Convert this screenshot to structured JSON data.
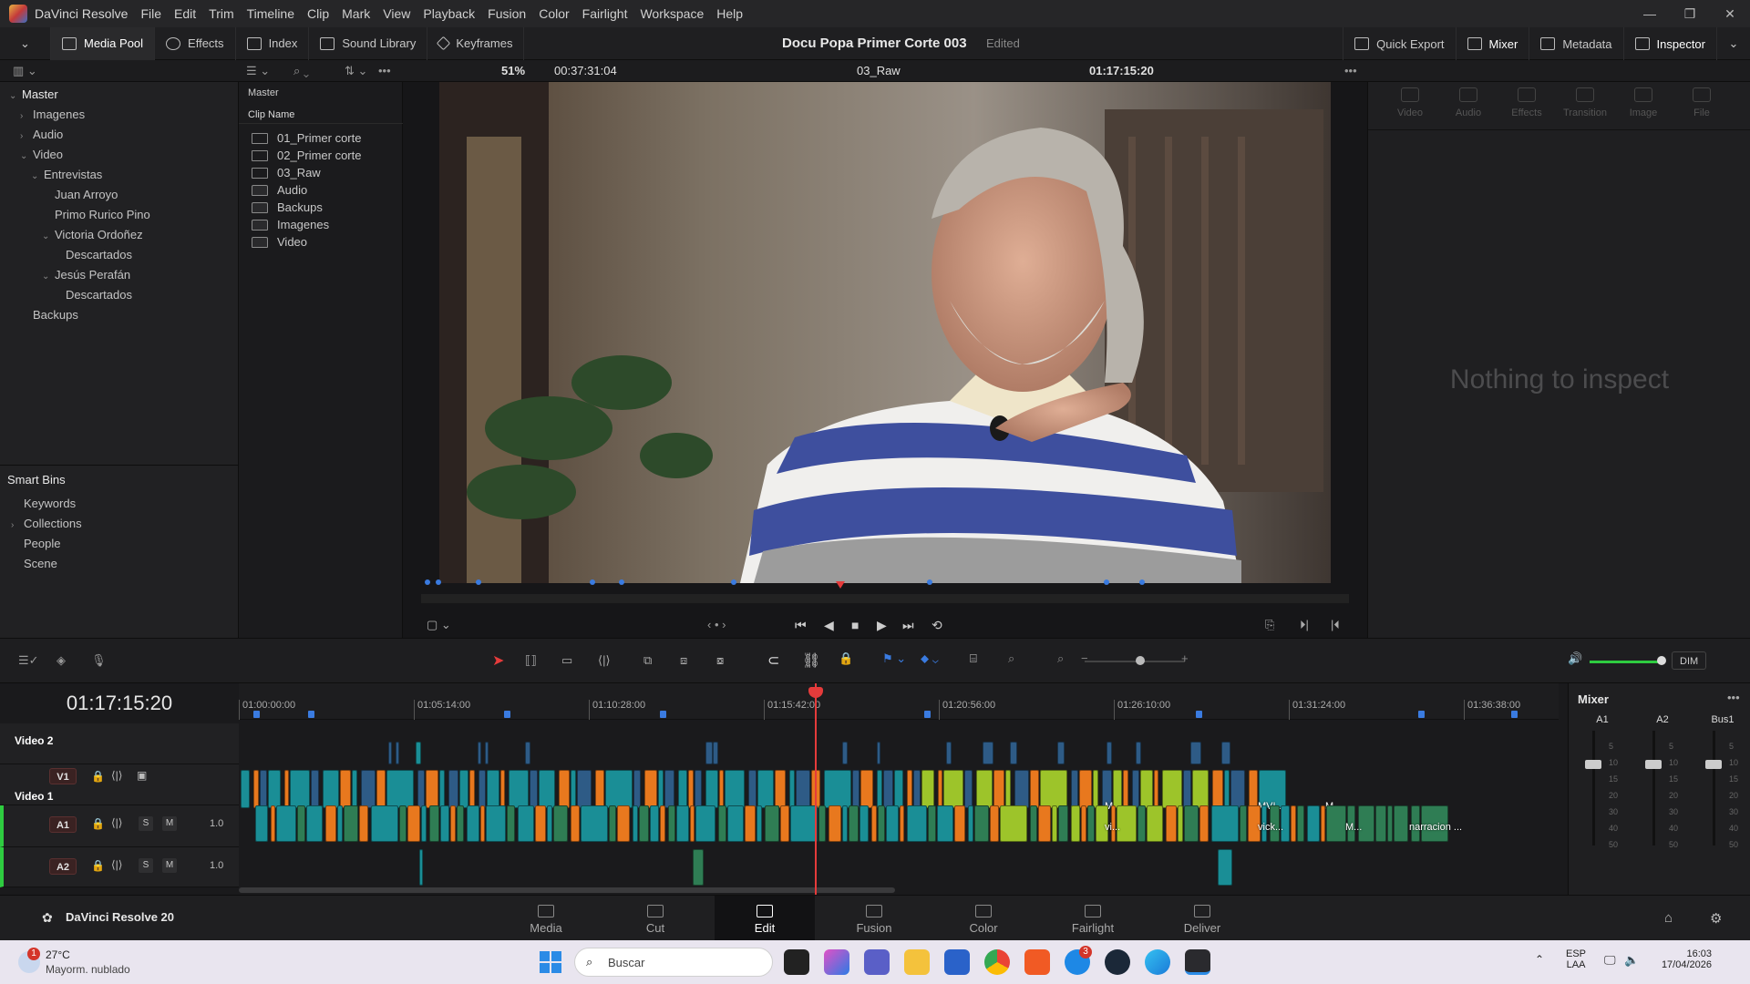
{
  "menubar": {
    "app_name": "DaVinci Resolve",
    "items": [
      "File",
      "Edit",
      "Trim",
      "Timeline",
      "Clip",
      "Mark",
      "View",
      "Playback",
      "Fusion",
      "Color",
      "Fairlight",
      "Workspace",
      "Help"
    ]
  },
  "toolbar": {
    "media_pool": "Media Pool",
    "effects": "Effects",
    "index": "Index",
    "sound_library": "Sound Library",
    "keyframes": "Keyframes",
    "project_title": "Docu Popa Primer Corte 003",
    "project_state": "Edited",
    "quick_export": "Quick Export",
    "mixer": "Mixer",
    "metadata": "Metadata",
    "inspector": "Inspector"
  },
  "subbar": {
    "zoom": "51%",
    "duration": "00:37:31:04",
    "clip_name": "03_Raw",
    "timecode": "01:17:15:20"
  },
  "bins": {
    "master": "Master",
    "items": [
      {
        "label": "Imagenes",
        "level": 1,
        "arrow": "›"
      },
      {
        "label": "Audio",
        "level": 1,
        "arrow": "›"
      },
      {
        "label": "Video",
        "level": 1,
        "arrow": "⌄"
      },
      {
        "label": "Entrevistas",
        "level": 2,
        "arrow": "⌄"
      },
      {
        "label": "Juan Arroyo",
        "level": 3,
        "arrow": ""
      },
      {
        "label": "Primo Rurico Pino",
        "level": 3,
        "arrow": ""
      },
      {
        "label": "Victoria Ordoñez",
        "level": 3,
        "arrow": "⌄"
      },
      {
        "label": "Descartados",
        "level": 4,
        "arrow": ""
      },
      {
        "label": "Jesús Perafán",
        "level": 3,
        "arrow": "⌄"
      },
      {
        "label": "Descartados",
        "level": 4,
        "arrow": ""
      },
      {
        "label": "Backups",
        "level": 1,
        "arrow": ""
      }
    ],
    "smart_bins": "Smart Bins",
    "smart_items": [
      {
        "label": "Keywords",
        "arrow": ""
      },
      {
        "label": "Collections",
        "arrow": "›"
      },
      {
        "label": "People",
        "arrow": ""
      },
      {
        "label": "Scene",
        "arrow": ""
      }
    ]
  },
  "clips": {
    "header": "Master",
    "column": "Clip Name",
    "items": [
      {
        "label": "01_Primer corte",
        "kind": "timeline"
      },
      {
        "label": "02_Primer corte",
        "kind": "timeline"
      },
      {
        "label": "03_Raw",
        "kind": "timeline"
      },
      {
        "label": "Audio",
        "kind": "folder"
      },
      {
        "label": "Backups",
        "kind": "folder"
      },
      {
        "label": "Imagenes",
        "kind": "folder"
      },
      {
        "label": "Video",
        "kind": "folder"
      }
    ]
  },
  "inspector": {
    "tabs": [
      "Video",
      "Audio",
      "Effects",
      "Transition",
      "Image",
      "File"
    ],
    "empty": "Nothing to inspect"
  },
  "timeline": {
    "timecode": "01:17:15:20",
    "ruler": [
      "01:00:00:00",
      "01:05:14:00",
      "01:10:28:00",
      "01:15:42:00",
      "01:20:56:00",
      "01:26:10:00",
      "01:31:24:00",
      "01:36:38:00"
    ],
    "tracks": {
      "v2": {
        "name": "Video 2"
      },
      "v1": {
        "badge": "V1",
        "name": "Video 1"
      },
      "a1": {
        "badge": "A1",
        "level": "1.0"
      },
      "a2": {
        "badge": "A2",
        "level": "1.0"
      }
    },
    "clip_labels": [
      "MVI...",
      "M...",
      "M...",
      "vi...",
      "vick...",
      "M...",
      "narracion ..."
    ],
    "solo": "S",
    "mute": "M"
  },
  "volume": {
    "dim": "DIM"
  },
  "mixer": {
    "title": "Mixer",
    "channels": [
      "A1",
      "A2",
      "Bus1"
    ],
    "scale": [
      "5",
      "10",
      "15",
      "20",
      "30",
      "40",
      "50"
    ]
  },
  "pages": {
    "brand": "DaVinci Resolve 20",
    "items": [
      "Media",
      "Cut",
      "Edit",
      "Fusion",
      "Color",
      "Fairlight",
      "Deliver"
    ],
    "active": "Edit"
  },
  "taskbar": {
    "weather_temp": "27°C",
    "weather_desc": "Mayorm. nublado",
    "weather_badge": "1",
    "search": "Buscar",
    "lang1": "ESP",
    "lang2": "LAA",
    "time": "16:03",
    "date": "17/04/2026",
    "brave_badge": "3"
  },
  "colors": {
    "teal": "#1a8e96",
    "blue": "#2e5b86",
    "orange": "#e8781e",
    "lime": "#9dc42a",
    "green_audio": "#2f7d54",
    "playhead": "#e53b3b"
  }
}
